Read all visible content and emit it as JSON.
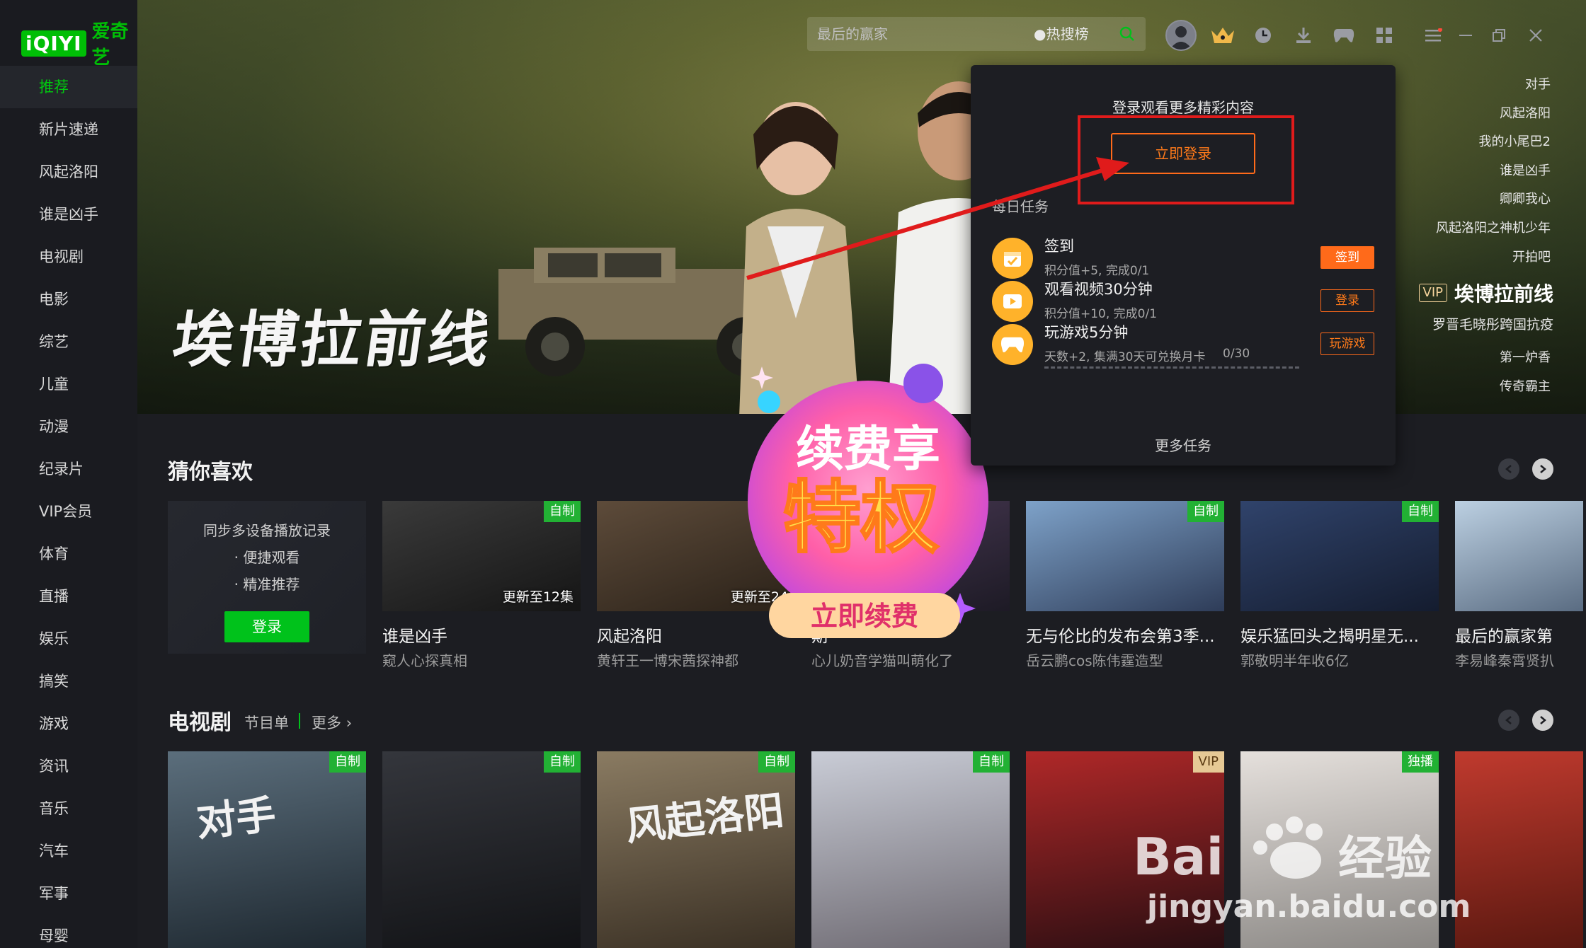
{
  "app": {
    "logo_mark": "iQIYI",
    "logo_text": "爱奇艺"
  },
  "sidebar": {
    "items": [
      "推荐",
      "新片速递",
      "风起洛阳",
      "谁是凶手",
      "电视剧",
      "电影",
      "综艺",
      "儿童",
      "动漫",
      "纪录片",
      "VIP会员",
      "体育",
      "直播",
      "娱乐",
      "搞笑",
      "游戏",
      "资讯",
      "音乐",
      "汽车",
      "军事",
      "母婴"
    ],
    "active_index": 0
  },
  "hero": {
    "title": "埃博拉前线"
  },
  "topbar": {
    "search_placeholder": "最后的赢家",
    "hot_label": "热搜榜"
  },
  "right_list": [
    "对手",
    "风起洛阳",
    "我的小尾巴2",
    "谁是凶手",
    "卿卿我心",
    "风起洛阳之神机少年",
    "开拍吧"
  ],
  "right_feature": {
    "vip": "VIP",
    "title": "埃博拉前线",
    "subtitle": "罗晋毛晓彤跨国抗疫"
  },
  "right_list2": [
    "第一炉香",
    "传奇霸主"
  ],
  "dropdown": {
    "heading": "登录观看更多精彩内容",
    "login_button": "立即登录",
    "section_label": "每日任务",
    "tasks": [
      {
        "name": "签到",
        "desc": "积分值+5, 完成0/1",
        "button": "签到",
        "progress": ""
      },
      {
        "name": "观看视频30分钟",
        "desc": "积分值+10, 完成0/1",
        "button": "登录",
        "progress": ""
      },
      {
        "name": "玩游戏5分钟",
        "desc": "天数+2, 集满30天可兑换月卡",
        "button": "玩游戏",
        "progress": "0/30"
      }
    ],
    "more": "更多任务"
  },
  "promo": {
    "line1": "续费享",
    "line2": "特权",
    "button": "立即续费"
  },
  "guess": {
    "title": "猜你喜欢",
    "login_card": {
      "line1": "同步多设备播放记录",
      "line2": "· 便捷观看",
      "line3": "· 精准推荐",
      "button": "登录"
    },
    "cards": [
      {
        "title": "谁是凶手",
        "sub": "窥人心探真相",
        "badge": "自制",
        "overlay": "更新至12集"
      },
      {
        "title": "风起洛阳",
        "sub": "黄轩王一博宋茜探神都",
        "badge": "",
        "overlay": "更新至24"
      },
      {
        "title": "期",
        "sub": "心儿奶音学猫叫萌化了",
        "badge": "",
        "overlay": ""
      },
      {
        "title": "无与伦比的发布会第3季...",
        "sub": "岳云鹏cos陈伟霆造型",
        "badge": "自制",
        "overlay": ""
      },
      {
        "title": "娱乐猛回头之揭明星无...",
        "sub": "郭敬明半年收6亿",
        "badge": "自制",
        "overlay": ""
      },
      {
        "title": "最后的赢家第",
        "sub": "李易峰秦霄贤扒",
        "badge": "",
        "overlay": ""
      }
    ]
  },
  "tv": {
    "title": "电视剧",
    "schedule": "节目单",
    "more": "更多",
    "cards": [
      {
        "badge": "自制",
        "badge_type": "green",
        "art": "对手"
      },
      {
        "badge": "自制",
        "badge_type": "green",
        "art": ""
      },
      {
        "badge": "自制",
        "badge_type": "green",
        "art": "风起洛阳"
      },
      {
        "badge": "自制",
        "badge_type": "green",
        "art": ""
      },
      {
        "badge": "VIP",
        "badge_type": "vip",
        "art": ""
      },
      {
        "badge": "独播",
        "badge_type": "green",
        "art": ""
      },
      {
        "badge": "",
        "badge_type": "",
        "art": ""
      }
    ]
  },
  "watermark": {
    "brand": "Bai",
    "brand2": "经验",
    "url": "jingyan.baidu.com"
  }
}
